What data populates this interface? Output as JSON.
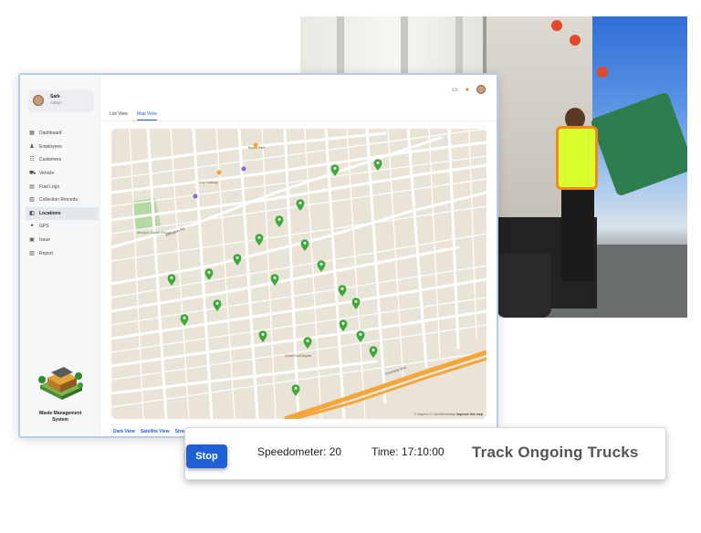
{
  "sidebar": {
    "user_name": "Sark",
    "user_role": "Admin",
    "items": [
      {
        "label": "Dashboard",
        "icon": "dashboard-icon",
        "glyph": "▦"
      },
      {
        "label": "Employees",
        "icon": "people-icon",
        "glyph": "♟"
      },
      {
        "label": "Customers",
        "icon": "customers-icon",
        "glyph": "☷"
      },
      {
        "label": "Vehicle",
        "icon": "truck-icon",
        "glyph": "⛟"
      },
      {
        "label": "Fuel Logs",
        "icon": "fuel-icon",
        "glyph": "▤"
      },
      {
        "label": "Collection Records",
        "icon": "records-icon",
        "glyph": "▥"
      },
      {
        "label": "Locations",
        "icon": "location-icon",
        "glyph": "◧",
        "active": true
      },
      {
        "label": "GPS",
        "icon": "gps-icon",
        "glyph": "✦"
      },
      {
        "label": "Issue",
        "icon": "issue-icon",
        "glyph": "▣"
      },
      {
        "label": "Report",
        "icon": "report-icon",
        "glyph": "▧"
      }
    ],
    "brand": "Waste Management System"
  },
  "tabs": [
    {
      "label": "List View",
      "active": false
    },
    {
      "label": "Map View",
      "active": true
    }
  ],
  "map": {
    "labels": {
      "rd": "Arlington Rd",
      "place1": "Arlington Middle School",
      "place2": "Bryant Park",
      "place3": "Cory Parkway",
      "place4": "Quest Park Baptist",
      "place5": "Oceanway Blvd"
    },
    "credit": "© Mapbox © OpenStreetMap",
    "credit_link": "Improve this map",
    "marker_color": "#3ea83a"
  },
  "map_types": [
    "Dark View",
    "Satellite View",
    "Streets View"
  ],
  "controls": {
    "stop_label": "Stop",
    "speedometer": "Speedometer: 20",
    "time": "Time: 17:10:00",
    "title": "Track Ongoing Trucks"
  },
  "colors": {
    "accent": "#1f5fd4",
    "marker": "#3ea83a",
    "highway": "#f4a63a"
  }
}
